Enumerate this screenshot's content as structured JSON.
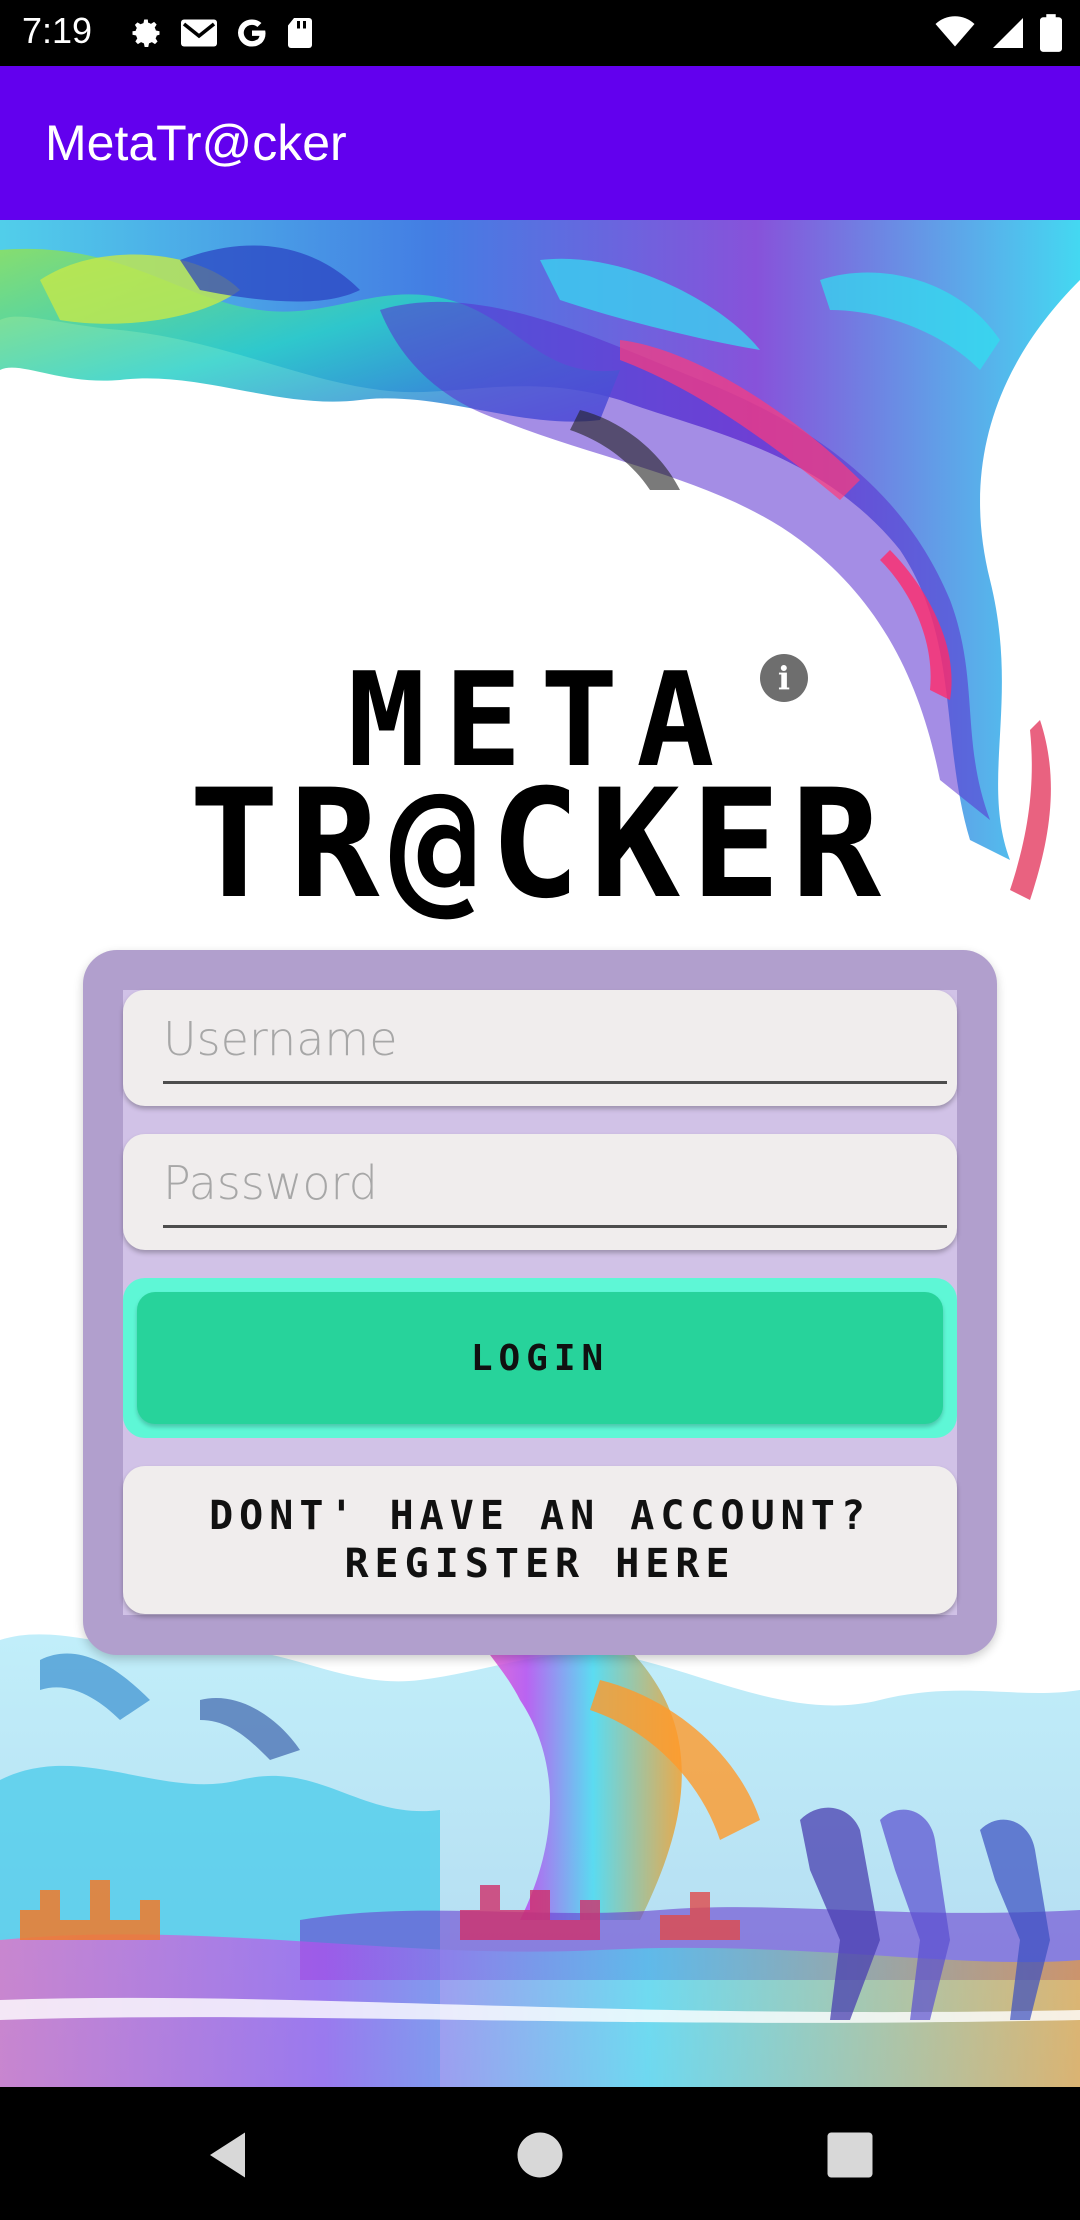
{
  "status_bar": {
    "time": "7:19",
    "left_icons": [
      "settings-icon",
      "gmail-icon",
      "google-icon",
      "sd-card-icon"
    ],
    "right_icons": [
      "wifi-icon",
      "signal-icon",
      "battery-icon"
    ]
  },
  "app_bar": {
    "title": "MetaTr@cker"
  },
  "logo": {
    "line1": "META",
    "line2": "TR@CKER",
    "info_icon": "info-icon"
  },
  "login_form": {
    "username_placeholder": "Username",
    "password_placeholder": "Password",
    "login_label": "LOGIN",
    "register_label": "DONT' HAVE AN ACCOUNT?\nREGISTER HERE"
  },
  "nav_bar": {
    "buttons": [
      "back-icon",
      "home-icon",
      "recents-icon"
    ]
  },
  "colors": {
    "app_bar": "#6200ee",
    "card": "#b19fcd",
    "login_button": "#27d39b",
    "login_button_glow": "#5ef7d6",
    "field_bg": "#f0eded"
  }
}
